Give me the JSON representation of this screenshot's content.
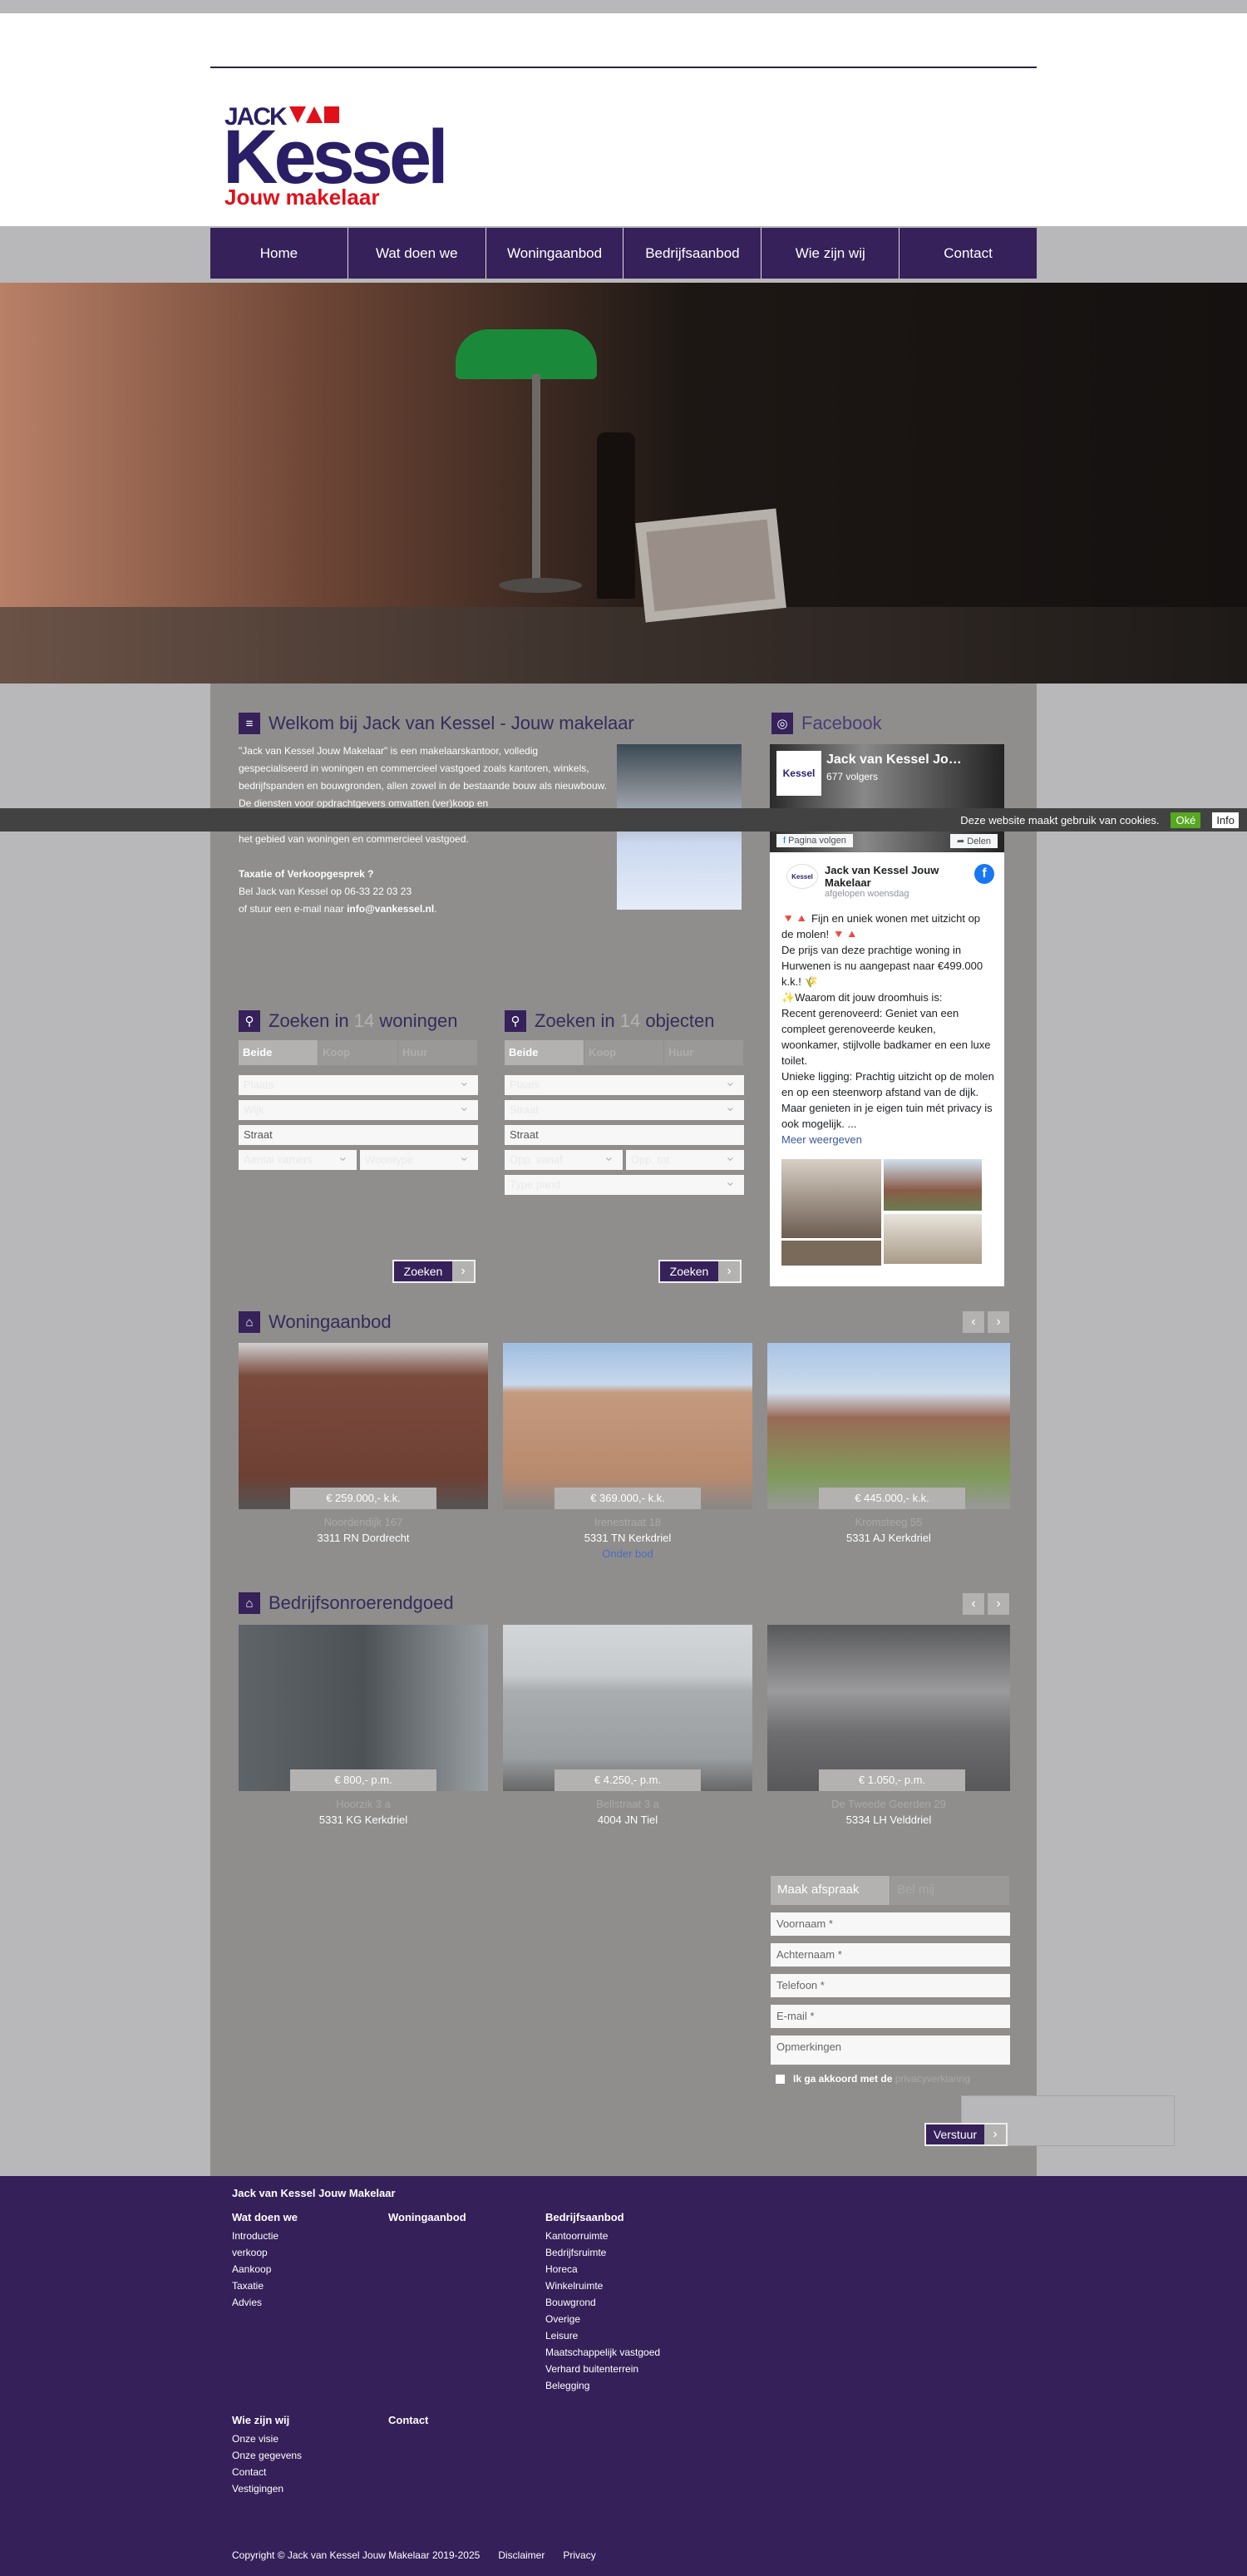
{
  "brand": {
    "logo_top": "JACK",
    "logo_main": "Kessel",
    "logo_sub": "Jouw makelaar",
    "purple": "#36215a",
    "red": "#e0101b"
  },
  "nav": [
    "Home",
    "Wat doen we",
    "Woningaanbod",
    "Bedrijfsaanbod",
    "Wie zijn wij",
    "Contact"
  ],
  "welcome": {
    "title": "Welkom bij Jack van Kessel - Jouw makelaar",
    "para1": "\"Jack van Kessel Jouw Makelaar\" is een makelaarskantoor, volledig gespecialiseerd in woningen en commercieel vastgoed zoals kantoren, winkels, bedrijfspanden en bouwgronden, allen zowel in de bestaande bouw als nieuwbouw. De diensten voor opdrachtgevers omvatten (ver)koop en",
    "para1_end": "het gebied van woningen en commercieel vastgoed.",
    "cta_title": "Taxatie of Verkoopgesprek ?",
    "cta_phone": "Bel Jack van Kessel op 06-33 22 03 23",
    "cta_mail_prefix": "of stuur een e-mail naar ",
    "cta_mail": "info@vankessel.nl",
    "cta_mail_suffix": "."
  },
  "cookie": {
    "text": "Deze website maakt gebruik van cookies.",
    "ok": "Oké",
    "info": "Info"
  },
  "facebook": {
    "title": "Facebook",
    "page_name": "Jack van Kessel Jo…",
    "followers": "677 volgers",
    "follow": "Pagina volgen",
    "share": "Delen",
    "post_author": "Jack van Kessel Jouw Makelaar",
    "post_time": "afgelopen woensdag",
    "post_lines": [
      "🔻🔺 Fijn en uniek wonen met uitzicht op de molen! 🔻🔺",
      "De prijs van deze prachtige woning in Hurwenen is nu aangepast naar €499.000 k.k.! 🌾",
      "✨Waarom dit jouw droomhuis is:",
      " Recent gerenoveerd: Geniet van een compleet gerenoveerde keuken, woonkamer, stijlvolle badkamer en een luxe toilet.",
      "Unieke ligging: Prachtig uitzicht op de molen en op een steenworp afstand van de dijk. Maar genieten in je eigen tuin mét privacy is ook mogelijk.  ..."
    ],
    "more": "Meer weergeven"
  },
  "search_homes": {
    "prefix": "Zoeken in ",
    "count": "14",
    "suffix": " woningen",
    "tabs": [
      "Beide",
      "Koop",
      "Huur"
    ],
    "fields": [
      "Plaats",
      "Wijk"
    ],
    "street": "Straat",
    "pair": [
      "Aantal kamers",
      "Woontype"
    ],
    "button": "Zoeken"
  },
  "search_objects": {
    "prefix": "Zoeken in ",
    "count": "14",
    "suffix": " objecten",
    "tabs": [
      "Beide",
      "Koop",
      "Huur"
    ],
    "fields": [
      "Plaats",
      "Straat"
    ],
    "street": "Straat",
    "pair": [
      "Opp. vanaf",
      "Opp. tot"
    ],
    "extra": "Type pand",
    "button": "Zoeken"
  },
  "homes": {
    "title": "Woningaanbod",
    "items": [
      {
        "price": "€ 259.000,- k.k.",
        "street": "Noordendijk 167",
        "city": "3311 RN Dordrecht",
        "status": ""
      },
      {
        "price": "€ 369.000,- k.k.",
        "street": "Irenestraat 18",
        "city": "5331 TN Kerkdriel",
        "status": "Onder bod"
      },
      {
        "price": "€ 445.000,- k.k.",
        "street": "Kromsteeg 55",
        "city": "5331 AJ Kerkdriel",
        "status": ""
      }
    ]
  },
  "business": {
    "title": "Bedrijfsonroerendgoed",
    "items": [
      {
        "price": "€ 800,- p.m.",
        "street": "Hoorzik 3 a",
        "city": "5331 KG Kerkdriel"
      },
      {
        "price": "€ 4.250,- p.m.",
        "street": "Bellstraat 3 a",
        "city": "4004 JN Tiel"
      },
      {
        "price": "€ 1.050,- p.m.",
        "street": "De Tweede Geerden 29",
        "city": "5334 LH Velddriel"
      }
    ]
  },
  "form": {
    "tabs": [
      "Maak afspraak",
      "Bel mij"
    ],
    "fields": [
      "Voornaam *",
      "Achternaam *",
      "Telefoon *",
      "E-mail *"
    ],
    "remarks": "Opmerkingen",
    "agree": "Ik ga akkoord met de ",
    "privacy": "privacyverklaring",
    "submit": "Verstuur"
  },
  "footer": {
    "company": "Jack van Kessel Jouw Makelaar",
    "cols": [
      {
        "title": "Wat doen we",
        "links": [
          "Introductie",
          "verkoop",
          "Aankoop",
          "Taxatie",
          "Advies"
        ]
      },
      {
        "title": "Woningaanbod",
        "links": []
      },
      {
        "title": "Bedrijfsaanbod",
        "links": [
          "Kantoorruimte",
          "Bedrijfsruimte",
          "Horeca",
          "Winkelruimte",
          "Bouwgrond",
          "Overige",
          "Leisure",
          "Maatschappelijk vastgoed",
          "Verhard buitenterrein",
          "Belegging"
        ]
      },
      {
        "title": "Wie zijn wij",
        "links": [
          "Onze visie",
          "Onze gegevens",
          "Contact",
          "Vestigingen"
        ]
      },
      {
        "title": "Contact",
        "links": []
      }
    ],
    "copyright": "Copyright © Jack van Kessel Jouw Makelaar 2019-2025",
    "disclaimer": "Disclaimer",
    "privacy": "Privacy"
  }
}
